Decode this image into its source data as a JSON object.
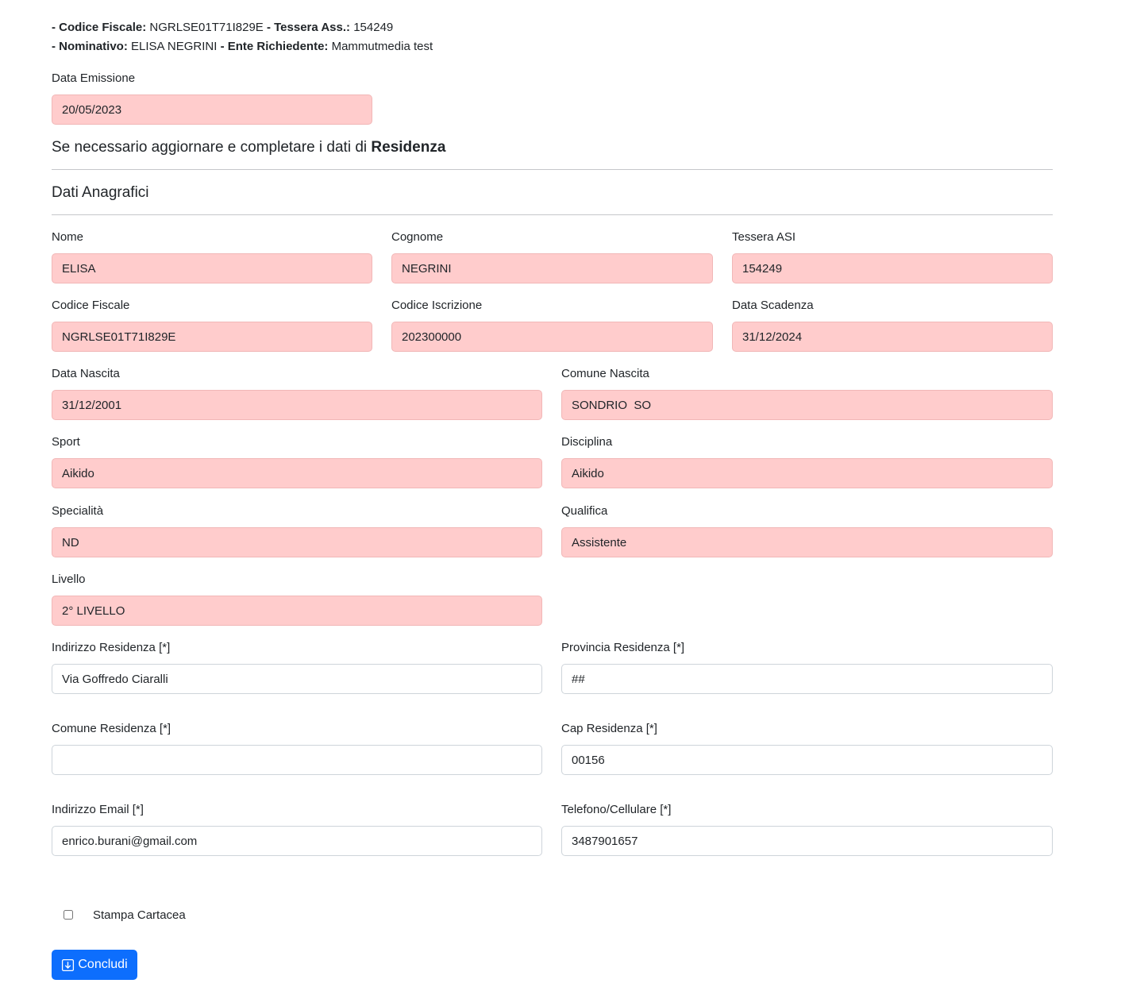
{
  "info": {
    "cf_label": "- Codice Fiscale:",
    "cf_value": "NGRLSE01T71I829E",
    "tessera_label": "- Tessera Ass.:",
    "tessera_value": "154249",
    "nominativo_label": "- Nominativo:",
    "nominativo_value": "ELISA NEGRINI",
    "ente_label": "- Ente Richiedente:",
    "ente_value": "Mammutmedia test"
  },
  "emissione": {
    "label": "Data Emissione",
    "value": "20/05/2023"
  },
  "residenza_heading": {
    "text": "Se necessario aggiornare e completare i dati di",
    "bold": "Residenza"
  },
  "anagrafici_heading": "Dati Anagrafici",
  "fields": {
    "nome": {
      "label": "Nome",
      "value": "ELISA"
    },
    "cognome": {
      "label": "Cognome",
      "value": "NEGRINI"
    },
    "tessera_asi": {
      "label": "Tessera ASI",
      "value": "154249"
    },
    "codice_fiscale": {
      "label": "Codice Fiscale",
      "value": "NGRLSE01T71I829E"
    },
    "codice_iscrizione": {
      "label": "Codice Iscrizione",
      "value": "202300000"
    },
    "data_scadenza": {
      "label": "Data Scadenza",
      "value": "31/12/2024"
    },
    "data_nascita": {
      "label": "Data Nascita",
      "value": "31/12/2001"
    },
    "comune_nascita": {
      "label": "Comune Nascita",
      "value": "SONDRIO  SO"
    },
    "sport": {
      "label": "Sport",
      "value": "Aikido"
    },
    "disciplina": {
      "label": "Disciplina",
      "value": "Aikido"
    },
    "specialita": {
      "label": "Specialità",
      "value": "ND"
    },
    "qualifica": {
      "label": "Qualifica",
      "value": "Assistente"
    },
    "livello": {
      "label": "Livello",
      "value": "2° LIVELLO"
    },
    "indirizzo_residenza": {
      "label": "Indirizzo Residenza [*]",
      "value": "Via Goffredo Ciaralli"
    },
    "provincia_residenza": {
      "label": "Provincia Residenza [*]",
      "value": "##"
    },
    "comune_residenza": {
      "label": "Comune Residenza [*]",
      "value": ""
    },
    "cap_residenza": {
      "label": "Cap Residenza [*]",
      "value": "00156"
    },
    "email": {
      "label": "Indirizzo Email [*]",
      "value": "enrico.burani@gmail.com"
    },
    "telefono": {
      "label": "Telefono/Cellulare [*]",
      "value": "3487901657"
    }
  },
  "stampa": {
    "label": "Stampa Cartacea",
    "checked": false
  },
  "submit": {
    "label": "Concludi",
    "icon": "download-icon"
  },
  "colors": {
    "readonly_bg": "#ffcccc",
    "primary": "#0d6efd"
  }
}
